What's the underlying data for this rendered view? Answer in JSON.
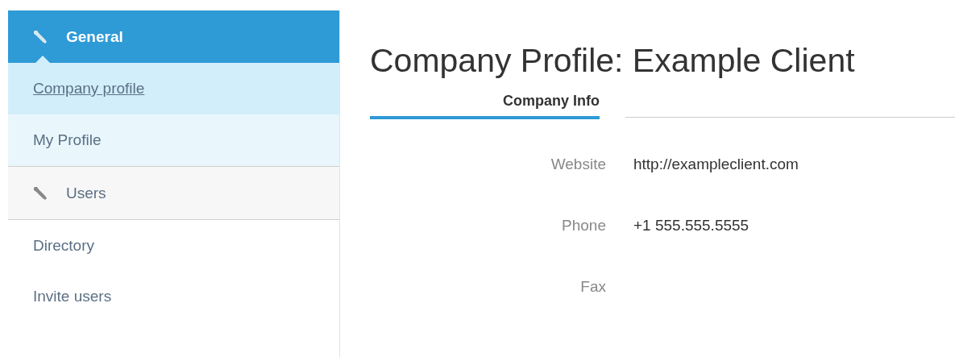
{
  "sidebar": {
    "sections": [
      {
        "label": "General",
        "active": true,
        "items": [
          {
            "label": "Company profile",
            "selected": true
          },
          {
            "label": "My Profile",
            "selected": false
          }
        ]
      },
      {
        "label": "Users",
        "active": false,
        "items": [
          {
            "label": "Directory",
            "selected": false
          },
          {
            "label": "Invite users",
            "selected": false
          }
        ]
      }
    ]
  },
  "page_title": "Company Profile: Example Client",
  "tabs": [
    {
      "label": "Company Info",
      "selected": true
    }
  ],
  "fields": [
    {
      "label": "Website",
      "value": "http://exampleclient.com"
    },
    {
      "label": "Phone",
      "value": "+1 555.555.5555"
    },
    {
      "label": "Fax"
    }
  ]
}
